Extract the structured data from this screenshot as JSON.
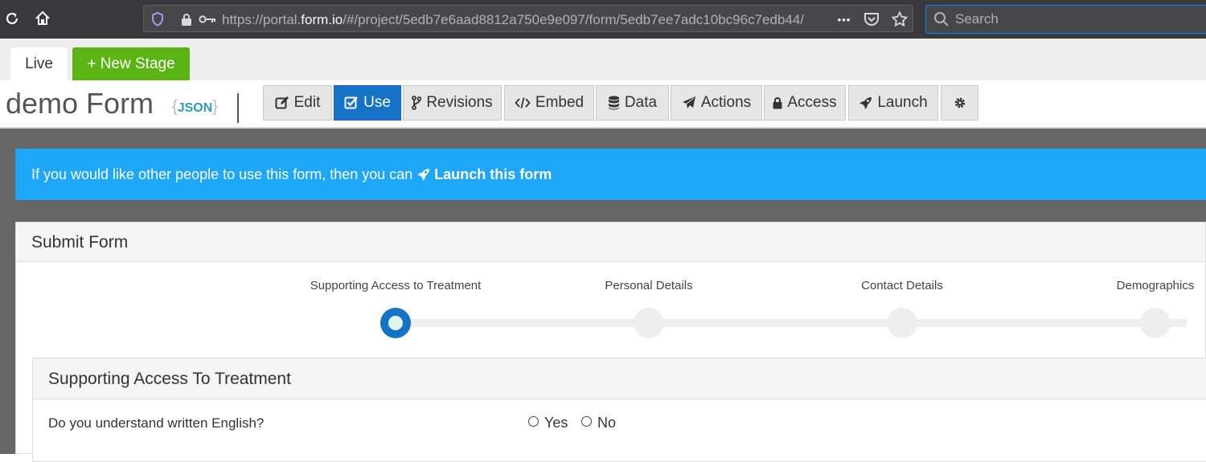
{
  "browser": {
    "url_prefix": "https://portal.",
    "url_domain": "form.io",
    "url_suffix": "/#/project/5edb7e6aad8812a750e9e097/form/5edb7ee7adc10bc96c7edb44/",
    "more_glyph": "•••",
    "search_placeholder": "Search"
  },
  "stages": {
    "live": "Live",
    "new_stage": "+ New Stage"
  },
  "header": {
    "form_title": "demo Form",
    "json_open": "{",
    "json_label": "JSON",
    "json_close": "}"
  },
  "toolbar": {
    "edit": "Edit",
    "use": "Use",
    "revisions": "Revisions",
    "embed": "Embed",
    "data": "Data",
    "actions": "Actions",
    "access": "Access",
    "launch": "Launch"
  },
  "alert": {
    "text": "If you would like other people to use this form, then you can",
    "link": "Launch this form"
  },
  "panel": {
    "title": "Submit Form",
    "wizard": [
      {
        "label": "Supporting Access to Treatment",
        "active": true
      },
      {
        "label": "Personal Details",
        "active": false
      },
      {
        "label": "Contact Details",
        "active": false
      },
      {
        "label": "Demographics",
        "active": false
      }
    ],
    "section_title": "Supporting Access To Treatment",
    "question": "Do you understand written English?",
    "options": [
      "Yes",
      "No"
    ]
  },
  "colors": {
    "accent": "#1572c6",
    "alert": "#1ea7f9",
    "new_stage": "#5cb414",
    "chrome": "#38383d"
  }
}
